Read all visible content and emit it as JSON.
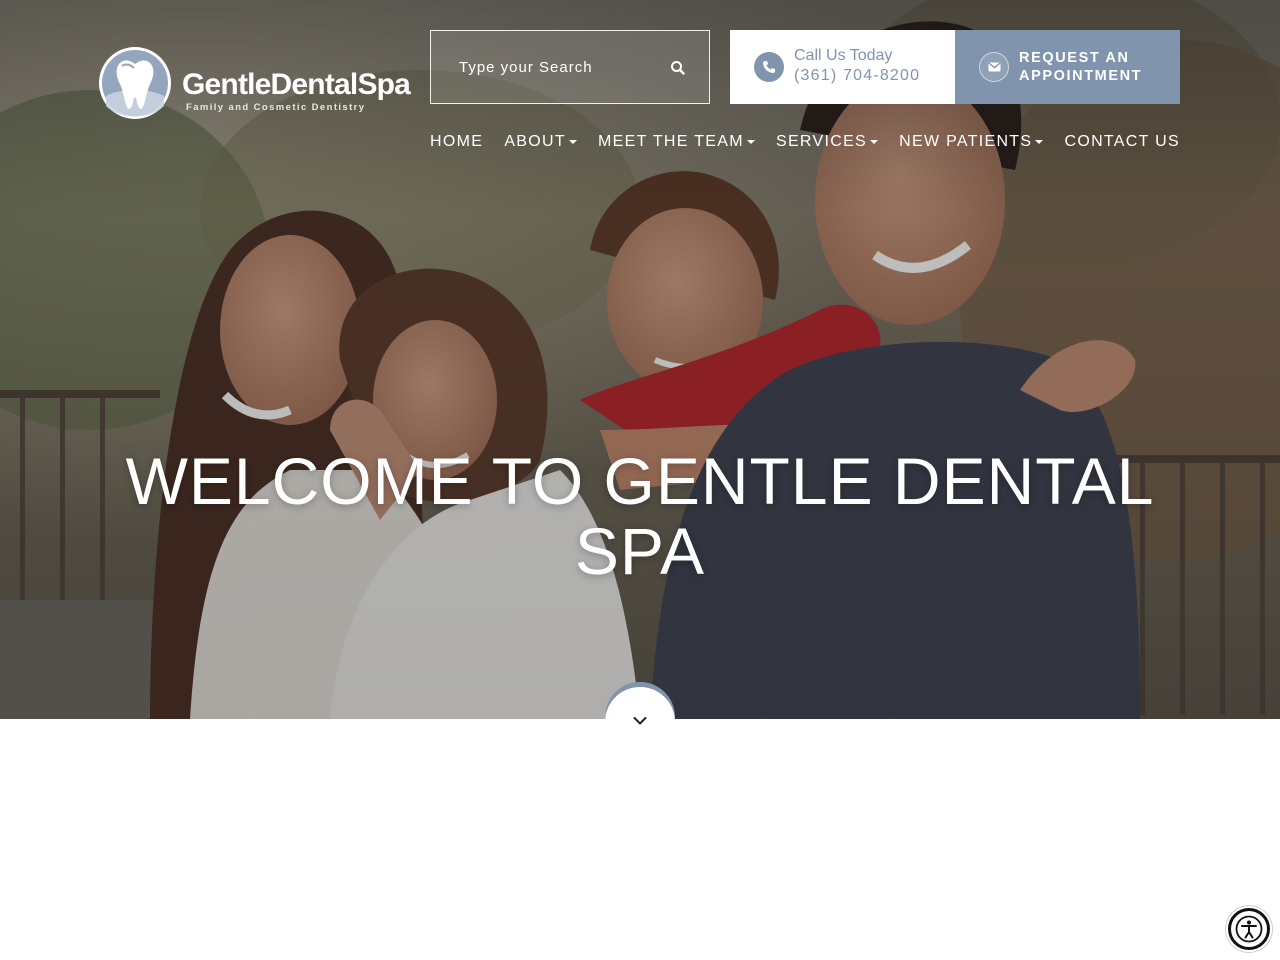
{
  "brand": {
    "name": "GentleDentalSpa",
    "tagline": "Family and Cosmetic Dentistry"
  },
  "search": {
    "placeholder": "Type your Search",
    "icon": "search-icon"
  },
  "contact": {
    "label": "Call Us Today",
    "phone": "(361) 704-8200",
    "icon": "phone-icon"
  },
  "appointment": {
    "label": "REQUEST AN APPOINTMENT",
    "icon": "envelope-icon"
  },
  "nav": {
    "items": [
      {
        "label": "HOME",
        "dropdown": false
      },
      {
        "label": "ABOUT",
        "dropdown": true
      },
      {
        "label": "MEET THE TEAM",
        "dropdown": true
      },
      {
        "label": "SERVICES",
        "dropdown": true
      },
      {
        "label": "NEW PATIENTS",
        "dropdown": true
      },
      {
        "label": "CONTACT US",
        "dropdown": false
      }
    ]
  },
  "hero": {
    "headline": "WELCOME TO GENTLE DENTAL SPA",
    "scroll_icon": "chevron-down-icon"
  },
  "accessibility": {
    "icon": "accessibility-icon"
  },
  "colors": {
    "accent": "#8094ad",
    "white": "#ffffff",
    "hero_tint": "#6b6558"
  }
}
